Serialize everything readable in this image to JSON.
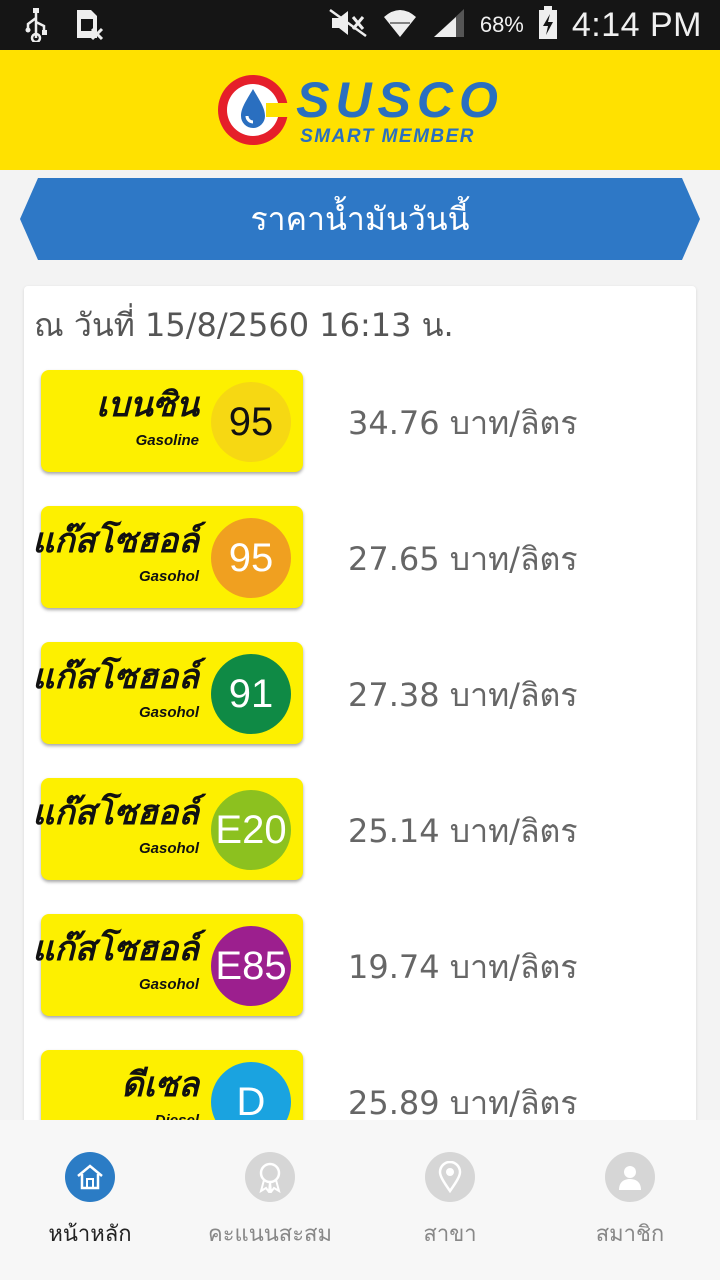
{
  "status_bar": {
    "battery_percent": "68%",
    "time": "4:14 PM",
    "icons": [
      "usb-icon",
      "sim-missing-icon",
      "mute-icon",
      "wifi-icon",
      "signal-icon",
      "battery-charging-icon"
    ]
  },
  "header": {
    "brand": "SUSCO",
    "brand_sub": "SMART MEMBER",
    "brand_color": "#2a6fc0",
    "background": "#ffe100"
  },
  "title": "ราคาน้ำมันวันนี้",
  "date_line": "ณ วันที่ 15/8/2560 16:13 น.",
  "fuels": [
    {
      "name_th": "เบนซิน",
      "name_en": "Gasoline",
      "grade": "95",
      "grade_color": "#f6d813",
      "grade_text": "dark",
      "price": "34.76 บาท/ลิตร"
    },
    {
      "name_th": "แก๊สโซฮอล์",
      "name_en": "Gasohol",
      "grade": "95",
      "grade_color": "#f0a020",
      "grade_text": "light",
      "price": "27.65 บาท/ลิตร"
    },
    {
      "name_th": "แก๊สโซฮอล์",
      "name_en": "Gasohol",
      "grade": "91",
      "grade_color": "#0f8a45",
      "grade_text": "light",
      "price": "27.38 บาท/ลิตร"
    },
    {
      "name_th": "แก๊สโซฮอล์",
      "name_en": "Gasohol",
      "grade": "E20",
      "grade_color": "#8cc11f",
      "grade_text": "light",
      "price": "25.14 บาท/ลิตร"
    },
    {
      "name_th": "แก๊สโซฮอล์",
      "name_en": "Gasohol",
      "grade": "E85",
      "grade_color": "#9c1f8e",
      "grade_text": "light",
      "price": "19.74 บาท/ลิตร"
    },
    {
      "name_th": "ดีเซล",
      "name_en": "Diesel",
      "grade": "D",
      "grade_color": "#1aa3e0",
      "grade_text": "light",
      "price": "25.89 บาท/ลิตร"
    }
  ],
  "nav": {
    "items": [
      {
        "label": "หน้าหลัก",
        "icon": "home-icon",
        "active": true
      },
      {
        "label": "คะแนนสะสม",
        "icon": "medal-icon",
        "active": false
      },
      {
        "label": "สาขา",
        "icon": "location-pin-icon",
        "active": false
      },
      {
        "label": "สมาชิก",
        "icon": "user-icon",
        "active": false
      }
    ],
    "active_color": "#2b7cc5"
  }
}
